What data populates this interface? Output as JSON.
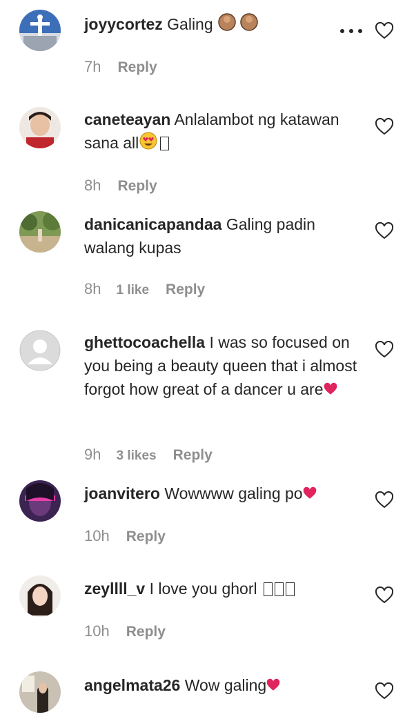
{
  "comments": [
    {
      "username": "joyycortez",
      "text": "Galing",
      "time": "7h",
      "likes": "",
      "reply": "Reply",
      "emoji": "clap-hands-x2",
      "avatar": "statue-avatar"
    },
    {
      "username": "caneteayan",
      "text": "Anlalambot ng katawan sana all",
      "time": "8h",
      "likes": "",
      "reply": "Reply",
      "emoji": "heart-eyes-face",
      "avatar": "person-avatar"
    },
    {
      "username": "danicanicapandaa",
      "text": "Galing padin walang kupas",
      "time": "8h",
      "likes": "1 like",
      "reply": "Reply",
      "avatar": "outdoor-avatar"
    },
    {
      "username": "ghettocoachella",
      "text": "I was so focused on you being a beauty queen that i almost forgot how great of a dancer u are",
      "time": "9h",
      "likes": "3 likes",
      "reply": "Reply",
      "emoji": "red-heart",
      "avatar": "default-avatar"
    },
    {
      "username": "joanvitero",
      "text": "Wowwww galing po",
      "time": "10h",
      "likes": "",
      "reply": "Reply",
      "emoji": "red-heart",
      "avatar": "pink-light-avatar"
    },
    {
      "username": "zeyllll_v",
      "text": "I love you ghorl",
      "time": "10h",
      "likes": "",
      "reply": "Reply",
      "avatar": "girl-avatar"
    },
    {
      "username": "angelmata26",
      "text": "Wow galing",
      "time": "",
      "likes": "",
      "reply": "",
      "emoji": "red-heart",
      "avatar": "room-avatar"
    }
  ],
  "colors": {
    "text": "#262626",
    "meta": "#8e8e8e",
    "heart_emoji": "#e0245e"
  }
}
